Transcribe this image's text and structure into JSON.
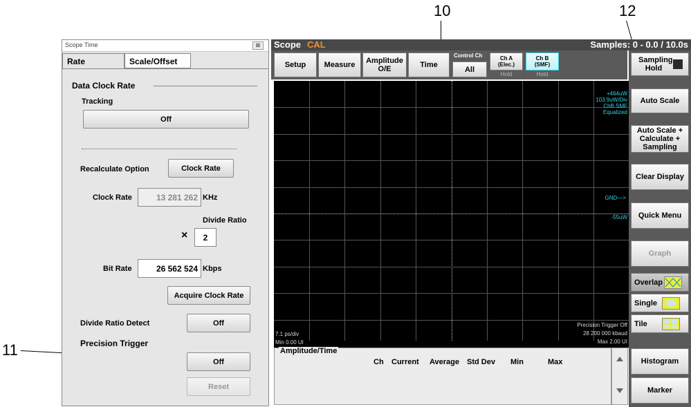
{
  "callouts": {
    "c10": "10",
    "c11": "11",
    "c12": "12"
  },
  "dialog": {
    "title": "Scope Time",
    "close_glyph": "⊠",
    "tabs": [
      "Rate",
      "Scale/Offset"
    ],
    "data_clock_rate_header": "Data Clock Rate",
    "tracking_label": "Tracking",
    "tracking_value": "Off",
    "recalculate_label": "Recalculate Option",
    "recalculate_value": "Clock Rate",
    "clock_rate_label": "Clock Rate",
    "clock_rate_value": "13 281 262",
    "clock_rate_unit": "KHz",
    "divide_ratio_label": "Divide Ratio",
    "times_glyph": "×",
    "divide_ratio_value": "2",
    "bit_rate_label": "Bit Rate",
    "bit_rate_value": "26 562 524",
    "bit_rate_unit": "Kbps",
    "acquire_label": "Acquire Clock Rate",
    "divide_detect_label": "Divide Ratio Detect",
    "divide_detect_value": "Off",
    "precision_trigger_header": "Precision Trigger",
    "precision_trigger_value": "Off",
    "reset_label": "Reset"
  },
  "scope": {
    "title": "Scope",
    "cal": "CAL",
    "samples": "Samples: 0 - 0.0 / 10.0s",
    "toolbar": {
      "setup": "Setup",
      "measure": "Measure",
      "amplitude": "Amplitude O/E",
      "time": "Time",
      "control_ch_label": "Control Ch",
      "control_ch_value": "All",
      "cha": "Ch A (Elec.)",
      "chb": "Ch B (SMF)",
      "hold": "Hold"
    },
    "plot": {
      "top_right": [
        "+464uW",
        "103.9uW/Div",
        "ChB SMF",
        "Equalized"
      ],
      "gnd": "GND—>",
      "neg": "-55uW",
      "bottom_left": [
        "7.1 ps/div",
        "Min 0.00 UI"
      ],
      "bottom_right": [
        "Precision Trigger Off",
        "28 200 000 kbaud",
        "Max 2.00 UI"
      ]
    },
    "measurement": {
      "title": "Amplitude/Time",
      "columns": [
        "Ch",
        "Current",
        "Average",
        "Std Dev",
        "Min",
        "Max"
      ]
    }
  },
  "rightbar": {
    "sampling": "Sampling Hold",
    "auto_scale": "Auto Scale",
    "auto_scale_calc": "Auto Scale + Calculate + Sampling",
    "clear_display": "Clear Display",
    "quick_menu": "Quick Menu",
    "graph": "Graph",
    "overlap": "Overlap",
    "single": "Single",
    "tile": "Tile",
    "histogram": "Histogram",
    "marker": "Marker"
  },
  "colors": {
    "accent_cyan": "#32d2e6",
    "cal_orange": "#e8903a",
    "overlap_yellow": "#e8ef3a"
  }
}
